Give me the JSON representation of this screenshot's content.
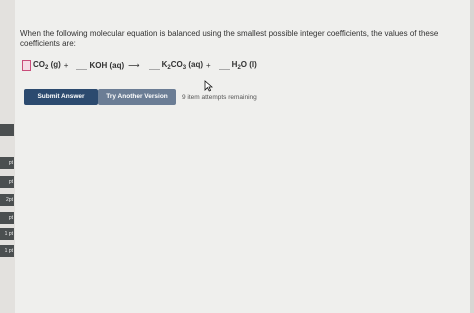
{
  "question": {
    "text": "When the following molecular equation is balanced using the smallest possible integer coefficients, the values of these coefficients are:"
  },
  "equation": {
    "reactant1": {
      "formula": "CO",
      "sub": "2",
      "state": "(g)"
    },
    "reactant2": {
      "formula": "KOH",
      "state": "(aq)"
    },
    "product1": {
      "formula_pre": "K",
      "sub1": "2",
      "formula_mid": "CO",
      "sub2": "3",
      "state": "(aq)"
    },
    "product2": {
      "formula_pre": "H",
      "sub": "2",
      "formula_post": "O",
      "state": "(l)"
    },
    "plus": "+",
    "arrow": "⟶",
    "coefficient_values": [
      "",
      "",
      "",
      ""
    ]
  },
  "actions": {
    "submit_label": "Submit Answer",
    "another_label": "Try Another Version",
    "attempts_text": "9 item attempts remaining"
  },
  "left_rail": {
    "items": [
      "",
      "pt",
      "pt",
      "2pt",
      "pt",
      "1 pt",
      "1 pt"
    ]
  },
  "colors": {
    "panel_background": "#efefed",
    "submit_button": "#2c4a6f",
    "another_button": "#6b7d95",
    "active_input_border": "#c94d7a"
  }
}
